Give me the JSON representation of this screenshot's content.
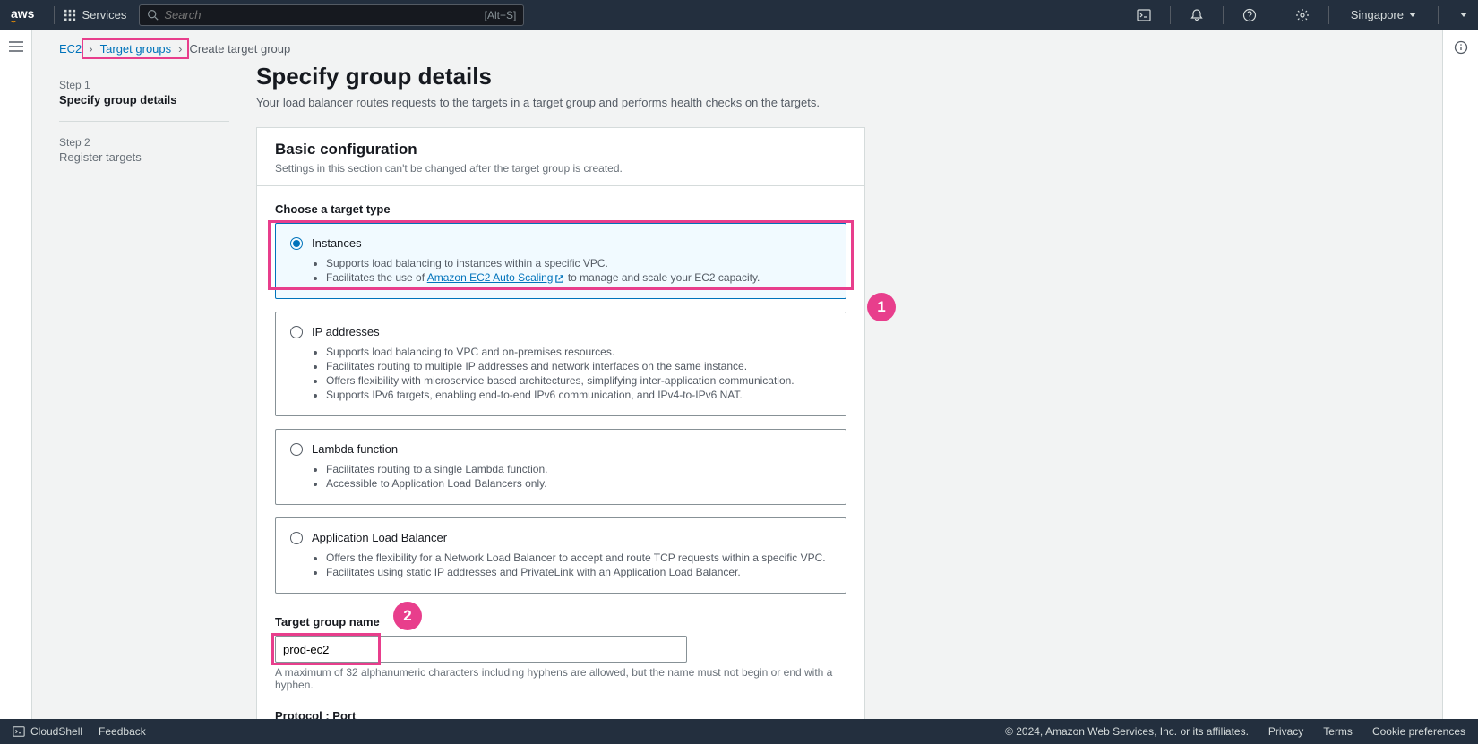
{
  "topnav": {
    "logo": "aws",
    "services": "Services",
    "search_placeholder": "Search",
    "search_hint": "[Alt+S]",
    "region": "Singapore"
  },
  "breadcrumb": {
    "root": "EC2",
    "mid": "Target groups",
    "current": "Create target group"
  },
  "wizard": {
    "step1_label": "Step 1",
    "step1_title": "Specify group details",
    "step2_label": "Step 2",
    "step2_title": "Register targets"
  },
  "page": {
    "title": "Specify group details",
    "desc": "Your load balancer routes requests to the targets in a target group and performs health checks on the targets."
  },
  "panel": {
    "title": "Basic configuration",
    "subtitle": "Settings in this section can't be changed after the target group is created."
  },
  "target_type": {
    "label": "Choose a target type",
    "instances": {
      "title": "Instances",
      "b1": "Supports load balancing to instances within a specific VPC.",
      "b2a": "Facilitates the use of ",
      "b2_link": "Amazon EC2 Auto Scaling",
      "b2b": " to manage and scale your EC2 capacity."
    },
    "ip": {
      "title": "IP addresses",
      "b1": "Supports load balancing to VPC and on-premises resources.",
      "b2": "Facilitates routing to multiple IP addresses and network interfaces on the same instance.",
      "b3": "Offers flexibility with microservice based architectures, simplifying inter-application communication.",
      "b4": "Supports IPv6 targets, enabling end-to-end IPv6 communication, and IPv4-to-IPv6 NAT."
    },
    "lambda": {
      "title": "Lambda function",
      "b1": "Facilitates routing to a single Lambda function.",
      "b2": "Accessible to Application Load Balancers only."
    },
    "alb": {
      "title": "Application Load Balancer",
      "b1": "Offers the flexibility for a Network Load Balancer to accept and route TCP requests within a specific VPC.",
      "b2": "Facilitates using static IP addresses and PrivateLink with an Application Load Balancer."
    }
  },
  "tg_name": {
    "label": "Target group name",
    "value": "prod-ec2",
    "helper": "A maximum of 32 alphanumeric characters including hyphens are allowed, but the name must not begin or end with a hyphen."
  },
  "protocol_label": "Protocol : Port",
  "annotations": {
    "a1": "1",
    "a2": "2"
  },
  "footer": {
    "cloudshell": "CloudShell",
    "feedback": "Feedback",
    "copyright": "© 2024, Amazon Web Services, Inc. or its affiliates.",
    "privacy": "Privacy",
    "terms": "Terms",
    "cookies": "Cookie preferences"
  }
}
